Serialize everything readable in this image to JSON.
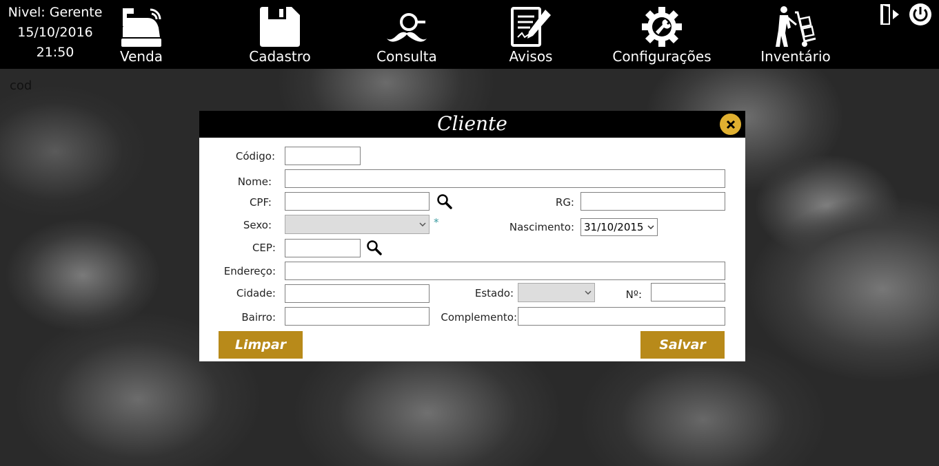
{
  "status": {
    "level": "Nivel: Gerente",
    "date": "15/10/2016",
    "time": "21:50"
  },
  "nav": [
    {
      "label": "Venda",
      "icon": "cash-register-icon"
    },
    {
      "label": "Cadastro",
      "icon": "save-disk-icon"
    },
    {
      "label": "Consulta",
      "icon": "mustache-magnifier-icon"
    },
    {
      "label": "Avisos",
      "icon": "document-edit-icon"
    },
    {
      "label": "Configurações",
      "icon": "gear-wrench-icon"
    },
    {
      "label": "Inventário",
      "icon": "hand-truck-icon"
    }
  ],
  "top_right": {
    "logout_icon": "logout-door-icon",
    "power_icon": "power-icon"
  },
  "background_label": "cod",
  "modal": {
    "title": "Cliente",
    "close_icon": "close-icon",
    "fields": {
      "codigo": {
        "label": "Código:",
        "value": ""
      },
      "nome": {
        "label": "Nome:",
        "value": ""
      },
      "cpf": {
        "label": "CPF:",
        "value": ""
      },
      "rg": {
        "label": "RG:",
        "value": ""
      },
      "sexo": {
        "label": "Sexo:",
        "value": "",
        "required_mark": "*"
      },
      "nascimento": {
        "label": "Nascimento:",
        "value": "31/10/2015"
      },
      "cep": {
        "label": "CEP:",
        "value": ""
      },
      "endereco": {
        "label": "Endereço:",
        "value": ""
      },
      "cidade": {
        "label": "Cidade:",
        "value": ""
      },
      "estado": {
        "label": "Estado:",
        "value": ""
      },
      "numero": {
        "label": "Nº:",
        "value": ""
      },
      "bairro": {
        "label": "Bairro:",
        "value": ""
      },
      "complemento": {
        "label": "Complemento:",
        "value": ""
      }
    },
    "buttons": {
      "clear": "Limpar",
      "save": "Salvar"
    }
  },
  "colors": {
    "accent_gold": "#b88a1a",
    "close_gold": "#e0b030",
    "header_black": "#000000",
    "required_teal": "#3a9aa0"
  }
}
